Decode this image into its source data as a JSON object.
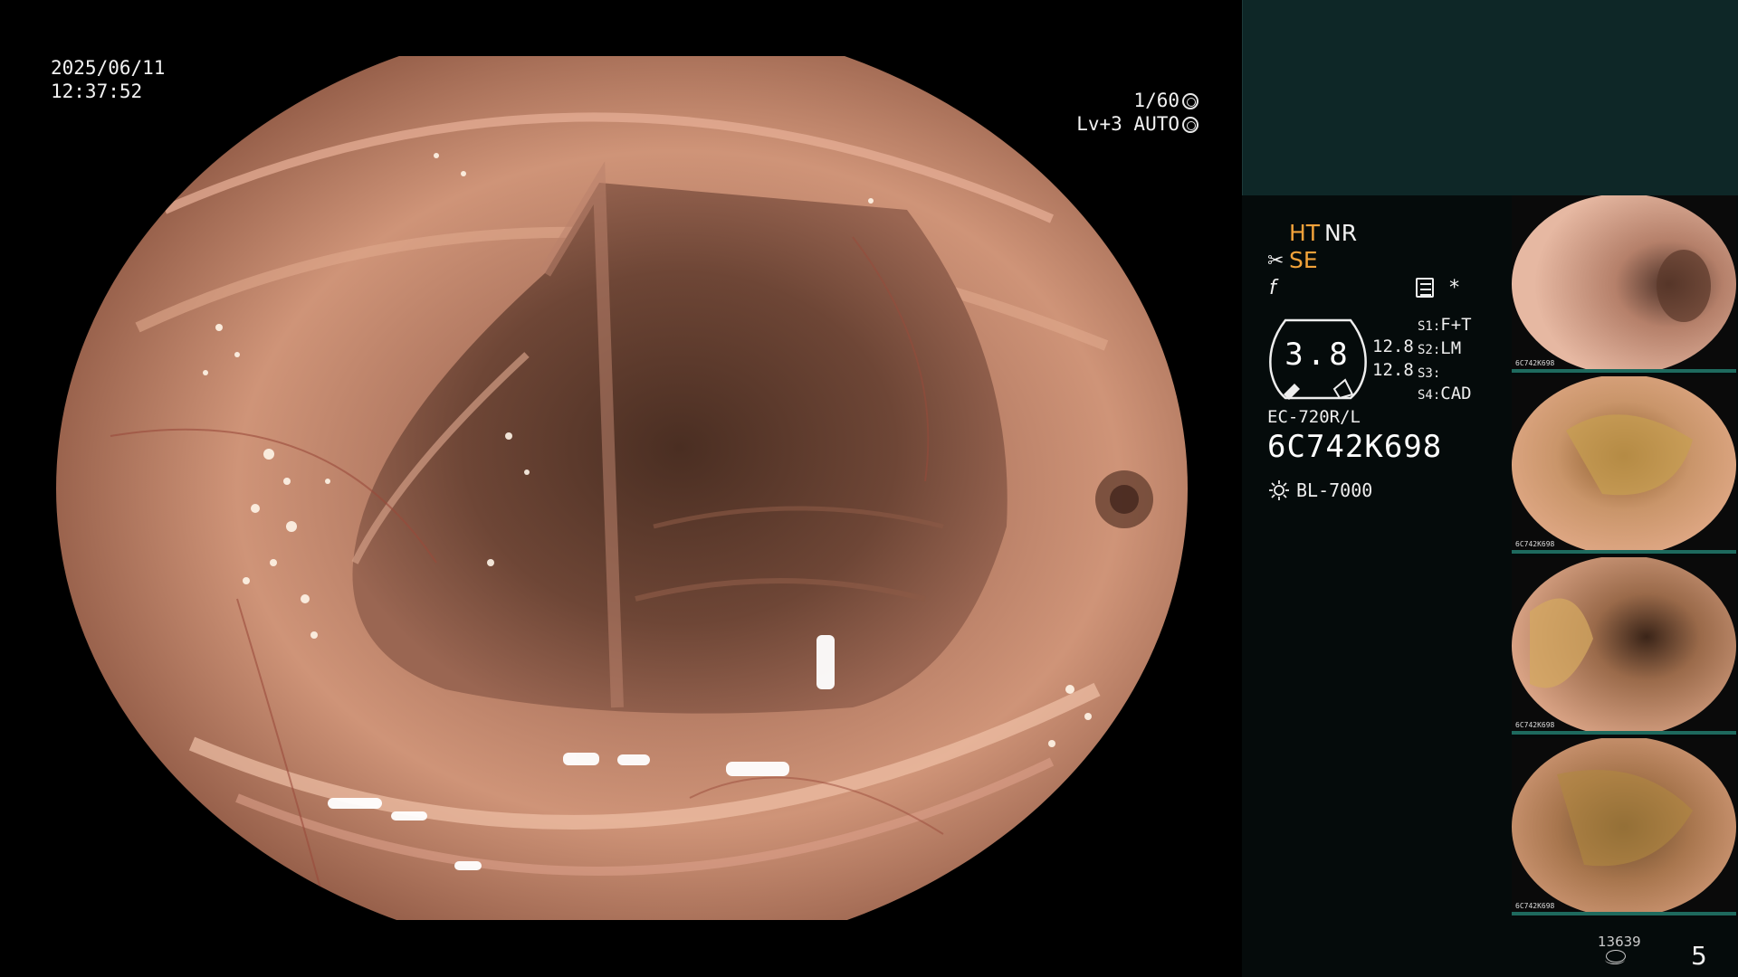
{
  "overlay": {
    "date": "2025/06/11",
    "time": "12:37:52",
    "shutter": "1/60",
    "level": "Lv+3",
    "exposure_mode": "AUTO"
  },
  "side_panel": {
    "mode_ht": "HT",
    "mode_nr": "NR",
    "mode_se": "SE",
    "icon_asterisk": "*",
    "gauge_value": "3.8",
    "value_a": "12.8",
    "value_b": "12.8",
    "s1_key": "S1:",
    "s1_val": "F+T",
    "s2_key": "S2:",
    "s2_val": "LM",
    "s3_key": "S3:",
    "s3_val": "",
    "s4_key": "S4:",
    "s4_val": "CAD",
    "scope_model": "EC-720R/L",
    "serial": "6C742K698",
    "light_source": "BL-7000"
  },
  "thumbnails": [
    {
      "label": "6C742K698"
    },
    {
      "label": "6C742K698"
    },
    {
      "label": "6C742K698"
    },
    {
      "label": "6C742K698"
    }
  ],
  "footer": {
    "count": "13639",
    "page": "5"
  },
  "colors": {
    "accent_orange": "#f2a23a",
    "panel_teal": "#0e2727",
    "mucosa": "#c88a6e"
  },
  "icons": [
    "shutter-icon",
    "auto-exposure-icon",
    "scissors-icon",
    "f-icon",
    "memo-icon",
    "sun-icon",
    "disk-icon"
  ]
}
